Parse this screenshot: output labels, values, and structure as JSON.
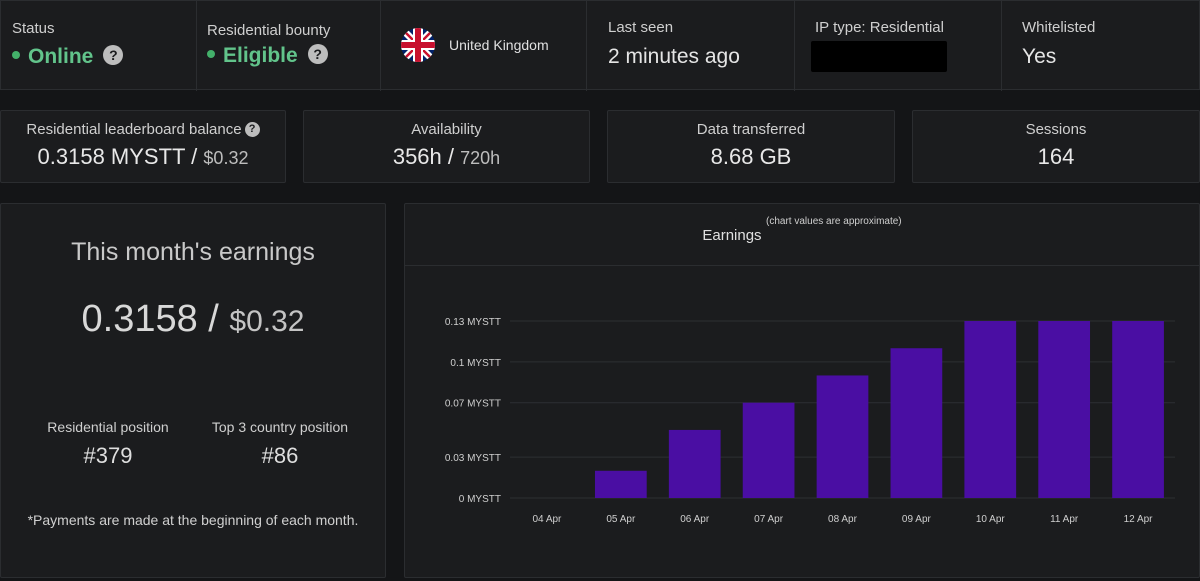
{
  "status": {
    "status_label": "Status",
    "status_value": "Online",
    "bounty_label": "Residential bounty",
    "bounty_value": "Eligible",
    "country": "United Kingdom",
    "last_seen_label": "Last seen",
    "last_seen_value": "2 minutes ago",
    "ip_type_label": "IP type: Residential",
    "whitelisted_label": "Whitelisted",
    "whitelisted_value": "Yes"
  },
  "metrics": {
    "balance_label": "Residential leaderboard balance",
    "balance_value": "0.3158 MYSTT /",
    "balance_usd": "$0.32",
    "availability_label": "Availability",
    "availability_value": "356h /",
    "availability_total": "720h",
    "data_label": "Data transferred",
    "data_value": "8.68 GB",
    "sessions_label": "Sessions",
    "sessions_value": "164"
  },
  "earnings_panel": {
    "title": "This month's earnings",
    "value": "0.3158 /",
    "value_usd": "$0.32",
    "res_position_label": "Residential position",
    "res_position_value": "#379",
    "country_position_label": "Top 3 country position",
    "country_position_value": "#86",
    "note": "*Payments are made at the beginning of each month."
  },
  "chart_header": {
    "title": "Earnings",
    "subtitle": "(chart values are approximate)"
  },
  "chart_data": {
    "type": "bar",
    "title": "Earnings",
    "subtitle": "(chart values are approximate)",
    "categories": [
      "04 Apr",
      "05 Apr",
      "06 Apr",
      "07 Apr",
      "08 Apr",
      "09 Apr",
      "10 Apr",
      "11 Apr",
      "12 Apr"
    ],
    "values": [
      0,
      0.02,
      0.05,
      0.07,
      0.09,
      0.11,
      0.13,
      0.13,
      0.13
    ],
    "y_ticks": [
      {
        "value": 0.13,
        "label": "0.13 MYSTT"
      },
      {
        "value": 0.1,
        "label": "0.1 MYSTT"
      },
      {
        "value": 0.07,
        "label": "0.07 MYSTT"
      },
      {
        "value": 0.03,
        "label": "0.03 MYSTT"
      },
      {
        "value": 0,
        "label": "0 MYSTT"
      }
    ],
    "ylim": [
      0,
      0.13
    ],
    "bar_color": "#4a0ea3",
    "grid": true
  }
}
